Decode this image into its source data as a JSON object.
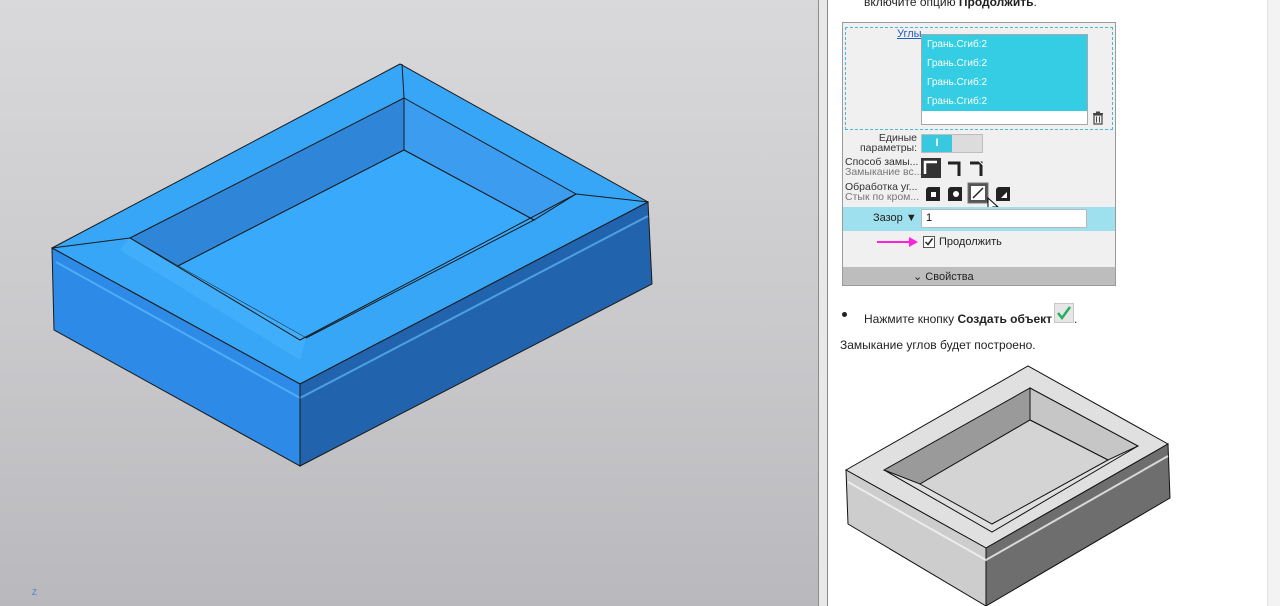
{
  "viewport": {
    "model_color": "#3aa2f5",
    "background_color": "#cfcfd1",
    "axis_label": "Z"
  },
  "help": {
    "top_text_prefix": "включите опцию ",
    "top_text_bold": "Продолжить",
    "top_text_suffix": ".",
    "panel": {
      "corners_link": "Углы",
      "corners_list": [
        "Грань.Сгиб:2",
        "Грань.Сгиб:2",
        "Грань.Сгиб:2",
        "Грань.Сгиб:2"
      ],
      "unified_params_label_line1": "Единые",
      "unified_params_label_line2": "параметры:",
      "toggle_on_label": "I",
      "closure_method_label": "Способ замы...",
      "closure_all_label": "Замыкание вс...",
      "corner_processing_label": "Обработка уг...",
      "edge_joint_label": "Стык по кром...",
      "gap_label": "Зазор",
      "gap_value": "1",
      "continue_label": "Продолжить",
      "continue_checked": true,
      "properties_label": "Свойства"
    },
    "bullet_text_prefix": "Нажмите кнопку ",
    "bullet_text_bold": "Создать объект",
    "bullet_text_suffix": ".",
    "result_text": "Замыкание углов будет построено.",
    "colors": {
      "list_highlight": "#35cde3",
      "toggle_on": "#38c8e0",
      "gap_row": "#9fe0ef",
      "arrow": "#ff22dd",
      "check_green": "#27ae60"
    }
  }
}
